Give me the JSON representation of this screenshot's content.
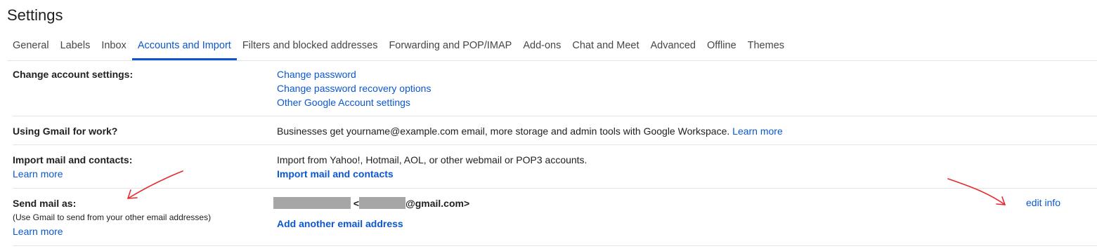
{
  "page": {
    "title": "Settings"
  },
  "tabs": [
    {
      "label": "General",
      "active": false
    },
    {
      "label": "Labels",
      "active": false
    },
    {
      "label": "Inbox",
      "active": false
    },
    {
      "label": "Accounts and Import",
      "active": true
    },
    {
      "label": "Filters and blocked addresses",
      "active": false
    },
    {
      "label": "Forwarding and POP/IMAP",
      "active": false
    },
    {
      "label": "Add-ons",
      "active": false
    },
    {
      "label": "Chat and Meet",
      "active": false
    },
    {
      "label": "Advanced",
      "active": false
    },
    {
      "label": "Offline",
      "active": false
    },
    {
      "label": "Themes",
      "active": false
    }
  ],
  "sections": {
    "change_account": {
      "label": "Change account settings:",
      "links": [
        "Change password",
        "Change password recovery options",
        "Other Google Account settings"
      ]
    },
    "gmail_work": {
      "label": "Using Gmail for work?",
      "text": "Businesses get yourname@example.com email, more storage and admin tools with Google Workspace.",
      "link": "Learn more"
    },
    "import_mail": {
      "label": "Import mail and contacts:",
      "learn_more": "Learn more",
      "text": "Import from Yahoo!, Hotmail, AOL, or other webmail or POP3 accounts.",
      "action": "Import mail and contacts"
    },
    "send_mail": {
      "label": "Send mail as:",
      "note": "(Use Gmail to send from your other email addresses)",
      "learn_more": "Learn more",
      "email_open": "<",
      "email_suffix": "@gmail.com>",
      "edit": "edit info",
      "add": "Add another email address"
    }
  },
  "colors": {
    "link": "#0b57d0",
    "annotation": "#e8282b",
    "divider": "#e3e3e3",
    "redaction": "#a6a6a6"
  }
}
